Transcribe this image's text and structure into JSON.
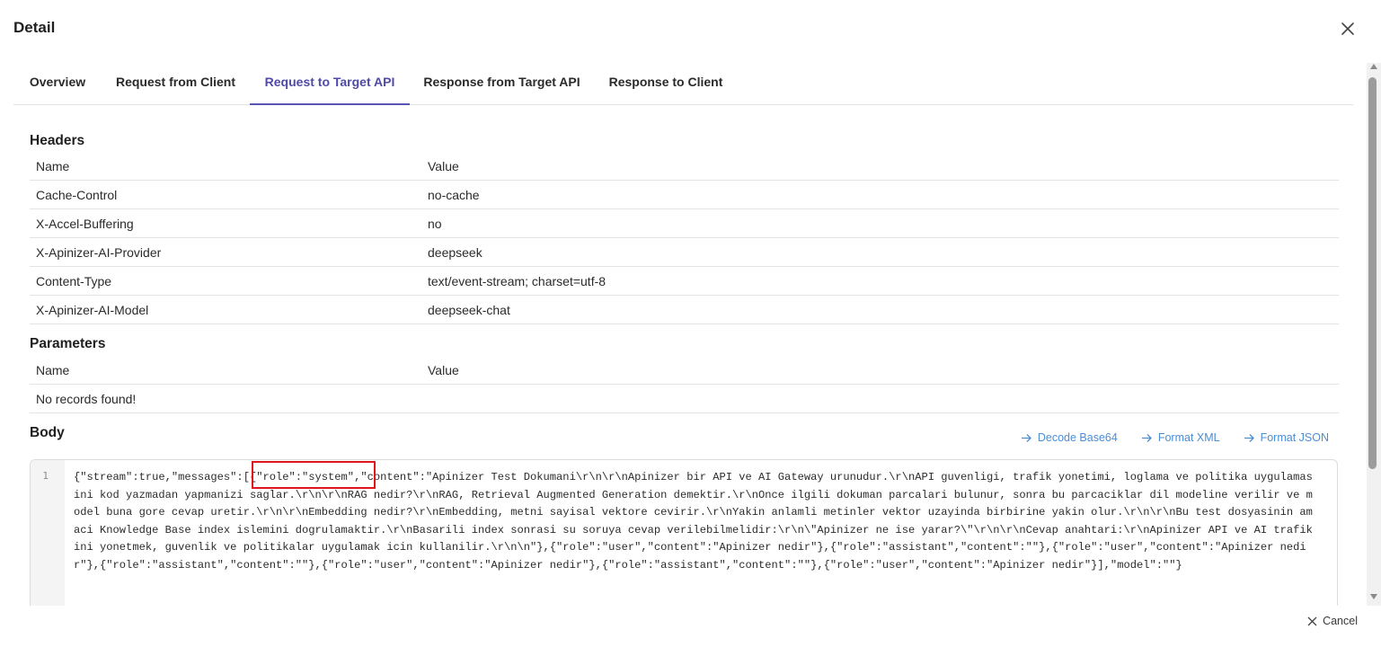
{
  "dialog": {
    "title": "Detail",
    "close_icon": "close-icon"
  },
  "tabs": [
    {
      "label": "Overview",
      "active": false
    },
    {
      "label": "Request from Client",
      "active": false
    },
    {
      "label": "Request to Target API",
      "active": true
    },
    {
      "label": "Response from Target API",
      "active": false
    },
    {
      "label": "Response to Client",
      "active": false
    }
  ],
  "headers": {
    "title": "Headers",
    "col_name": "Name",
    "col_value": "Value",
    "rows": [
      {
        "name": "Cache-Control",
        "value": "no-cache"
      },
      {
        "name": "X-Accel-Buffering",
        "value": "no"
      },
      {
        "name": "X-Apinizer-AI-Provider",
        "value": "deepseek"
      },
      {
        "name": "Content-Type",
        "value": "text/event-stream; charset=utf-8"
      },
      {
        "name": "X-Apinizer-AI-Model",
        "value": "deepseek-chat"
      }
    ]
  },
  "parameters": {
    "title": "Parameters",
    "col_name": "Name",
    "col_value": "Value",
    "empty_text": "No records found!"
  },
  "body": {
    "title": "Body",
    "actions": {
      "decode_base64": "Decode Base64",
      "format_xml": "Format XML",
      "format_json": "Format JSON"
    },
    "line_number": "1",
    "code": "{\"stream\":true,\"messages\":[{\"role\":\"system\",\"content\":\"Apinizer Test Dokumani\\r\\n\\r\\nApinizer bir API ve AI Gateway urunudur.\\r\\nAPI guvenligi, trafik yonetimi, loglama ve politika uygulamasini kod yazmadan yapmanizi saglar.\\r\\n\\r\\nRAG nedir?\\r\\nRAG, Retrieval Augmented Generation demektir.\\r\\nOnce ilgili dokuman parcalari bulunur, sonra bu parcaciklar dil modeline verilir ve model buna gore cevap uretir.\\r\\n\\r\\nEmbedding nedir?\\r\\nEmbedding, metni sayisal vektore cevirir.\\r\\nYakin anlamli metinler vektor uzayinda birbirine yakin olur.\\r\\n\\r\\nBu test dosyasinin amaci Knowledge Base index islemini dogrulamaktir.\\r\\nBasarili index sonrasi su soruya cevap verilebilmelidir:\\r\\n\\\"Apinizer ne ise yarar?\\\"\\r\\n\\r\\nCevap anahtari:\\r\\nApinizer API ve AI trafikini yonetmek, guvenlik ve politikalar uygulamak icin kullanilir.\\r\\n\\n\"},{\"role\":\"user\",\"content\":\"Apinizer nedir\"},{\"role\":\"assistant\",\"content\":\"\"},{\"role\":\"user\",\"content\":\"Apinizer nedir\"},{\"role\":\"assistant\",\"content\":\"\"},{\"role\":\"user\",\"content\":\"Apinizer nedir\"},{\"role\":\"assistant\",\"content\":\"\"},{\"role\":\"user\",\"content\":\"Apinizer nedir\"}],\"model\":\"\"}"
  },
  "footer": {
    "cancel_label": "Cancel"
  },
  "colors": {
    "accent": "#4f4aa8",
    "link": "#4a8ed6",
    "highlight": "#e0141b"
  }
}
